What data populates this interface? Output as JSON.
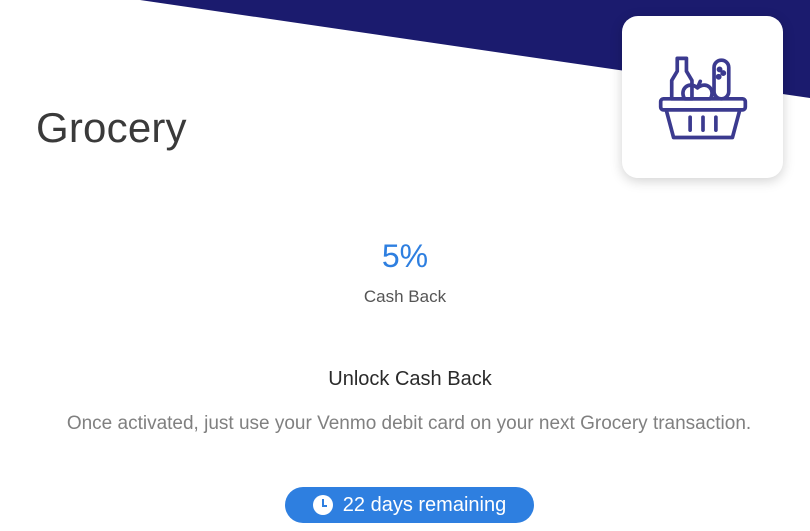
{
  "colors": {
    "banner": "#1b1b6e",
    "accent": "#2e7fe0",
    "icon_stroke": "#3b3a8f"
  },
  "offer": {
    "category": "Grocery",
    "icon": "grocery-basket-icon",
    "percent": "5%",
    "cashback_label": "Cash Back"
  },
  "unlock": {
    "title": "Unlock Cash Back",
    "description": "Once activated, just use your Venmo debit card on your next Grocery transaction."
  },
  "timer": {
    "icon": "clock-icon",
    "label": "22 days remaining"
  }
}
